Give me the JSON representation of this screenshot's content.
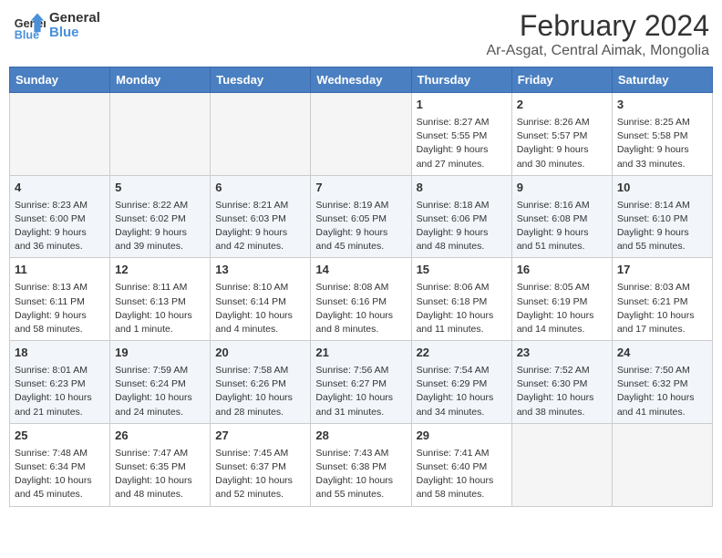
{
  "header": {
    "logo_line1": "General",
    "logo_line2": "Blue",
    "title": "February 2024",
    "subtitle": "Ar-Asgat, Central Aimak, Mongolia"
  },
  "days_of_week": [
    "Sunday",
    "Monday",
    "Tuesday",
    "Wednesday",
    "Thursday",
    "Friday",
    "Saturday"
  ],
  "weeks": [
    [
      {
        "date": "",
        "info": ""
      },
      {
        "date": "",
        "info": ""
      },
      {
        "date": "",
        "info": ""
      },
      {
        "date": "",
        "info": ""
      },
      {
        "date": "1",
        "info": "Sunrise: 8:27 AM\nSunset: 5:55 PM\nDaylight: 9 hours and 27 minutes."
      },
      {
        "date": "2",
        "info": "Sunrise: 8:26 AM\nSunset: 5:57 PM\nDaylight: 9 hours and 30 minutes."
      },
      {
        "date": "3",
        "info": "Sunrise: 8:25 AM\nSunset: 5:58 PM\nDaylight: 9 hours and 33 minutes."
      }
    ],
    [
      {
        "date": "4",
        "info": "Sunrise: 8:23 AM\nSunset: 6:00 PM\nDaylight: 9 hours and 36 minutes."
      },
      {
        "date": "5",
        "info": "Sunrise: 8:22 AM\nSunset: 6:02 PM\nDaylight: 9 hours and 39 minutes."
      },
      {
        "date": "6",
        "info": "Sunrise: 8:21 AM\nSunset: 6:03 PM\nDaylight: 9 hours and 42 minutes."
      },
      {
        "date": "7",
        "info": "Sunrise: 8:19 AM\nSunset: 6:05 PM\nDaylight: 9 hours and 45 minutes."
      },
      {
        "date": "8",
        "info": "Sunrise: 8:18 AM\nSunset: 6:06 PM\nDaylight: 9 hours and 48 minutes."
      },
      {
        "date": "9",
        "info": "Sunrise: 8:16 AM\nSunset: 6:08 PM\nDaylight: 9 hours and 51 minutes."
      },
      {
        "date": "10",
        "info": "Sunrise: 8:14 AM\nSunset: 6:10 PM\nDaylight: 9 hours and 55 minutes."
      }
    ],
    [
      {
        "date": "11",
        "info": "Sunrise: 8:13 AM\nSunset: 6:11 PM\nDaylight: 9 hours and 58 minutes."
      },
      {
        "date": "12",
        "info": "Sunrise: 8:11 AM\nSunset: 6:13 PM\nDaylight: 10 hours and 1 minute."
      },
      {
        "date": "13",
        "info": "Sunrise: 8:10 AM\nSunset: 6:14 PM\nDaylight: 10 hours and 4 minutes."
      },
      {
        "date": "14",
        "info": "Sunrise: 8:08 AM\nSunset: 6:16 PM\nDaylight: 10 hours and 8 minutes."
      },
      {
        "date": "15",
        "info": "Sunrise: 8:06 AM\nSunset: 6:18 PM\nDaylight: 10 hours and 11 minutes."
      },
      {
        "date": "16",
        "info": "Sunrise: 8:05 AM\nSunset: 6:19 PM\nDaylight: 10 hours and 14 minutes."
      },
      {
        "date": "17",
        "info": "Sunrise: 8:03 AM\nSunset: 6:21 PM\nDaylight: 10 hours and 17 minutes."
      }
    ],
    [
      {
        "date": "18",
        "info": "Sunrise: 8:01 AM\nSunset: 6:23 PM\nDaylight: 10 hours and 21 minutes."
      },
      {
        "date": "19",
        "info": "Sunrise: 7:59 AM\nSunset: 6:24 PM\nDaylight: 10 hours and 24 minutes."
      },
      {
        "date": "20",
        "info": "Sunrise: 7:58 AM\nSunset: 6:26 PM\nDaylight: 10 hours and 28 minutes."
      },
      {
        "date": "21",
        "info": "Sunrise: 7:56 AM\nSunset: 6:27 PM\nDaylight: 10 hours and 31 minutes."
      },
      {
        "date": "22",
        "info": "Sunrise: 7:54 AM\nSunset: 6:29 PM\nDaylight: 10 hours and 34 minutes."
      },
      {
        "date": "23",
        "info": "Sunrise: 7:52 AM\nSunset: 6:30 PM\nDaylight: 10 hours and 38 minutes."
      },
      {
        "date": "24",
        "info": "Sunrise: 7:50 AM\nSunset: 6:32 PM\nDaylight: 10 hours and 41 minutes."
      }
    ],
    [
      {
        "date": "25",
        "info": "Sunrise: 7:48 AM\nSunset: 6:34 PM\nDaylight: 10 hours and 45 minutes."
      },
      {
        "date": "26",
        "info": "Sunrise: 7:47 AM\nSunset: 6:35 PM\nDaylight: 10 hours and 48 minutes."
      },
      {
        "date": "27",
        "info": "Sunrise: 7:45 AM\nSunset: 6:37 PM\nDaylight: 10 hours and 52 minutes."
      },
      {
        "date": "28",
        "info": "Sunrise: 7:43 AM\nSunset: 6:38 PM\nDaylight: 10 hours and 55 minutes."
      },
      {
        "date": "29",
        "info": "Sunrise: 7:41 AM\nSunset: 6:40 PM\nDaylight: 10 hours and 58 minutes."
      },
      {
        "date": "",
        "info": ""
      },
      {
        "date": "",
        "info": ""
      }
    ]
  ]
}
